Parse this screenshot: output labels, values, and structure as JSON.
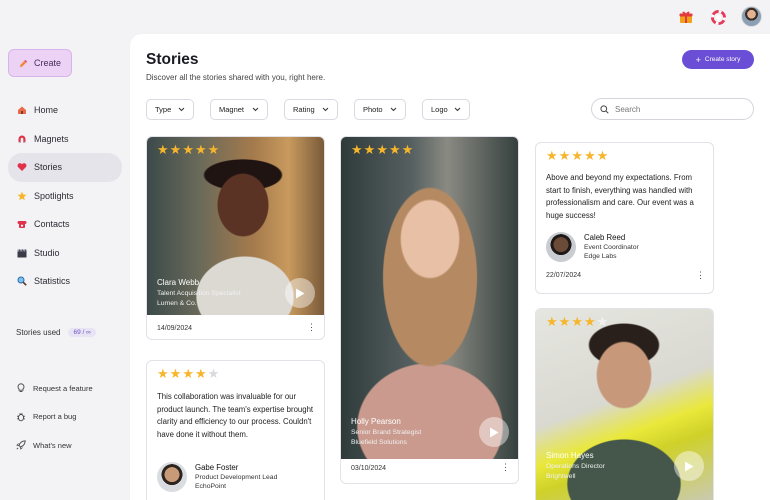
{
  "topbar": {
    "icons": [
      "gift-icon",
      "help-ring-icon",
      "user-avatar"
    ]
  },
  "sidebar": {
    "create_label": "Create",
    "items": [
      {
        "label": "Home",
        "icon": "home-icon"
      },
      {
        "label": "Magnets",
        "icon": "magnet-icon"
      },
      {
        "label": "Stories",
        "icon": "heart-icon",
        "active": true
      },
      {
        "label": "Spotlights",
        "icon": "star-icon"
      },
      {
        "label": "Contacts",
        "icon": "phone-icon"
      },
      {
        "label": "Studio",
        "icon": "clapper-icon"
      },
      {
        "label": "Statistics",
        "icon": "magnifier-icon"
      }
    ],
    "usage_label": "Stories used",
    "usage_value": "69 / ∞",
    "footer": [
      {
        "label": "Request a feature",
        "icon": "bulb-icon"
      },
      {
        "label": "Report a bug",
        "icon": "bug-icon"
      },
      {
        "label": "What's new",
        "icon": "rocket-icon"
      }
    ]
  },
  "main": {
    "title": "Stories",
    "subtitle": "Discover all the stories shared with you, right here.",
    "create_story_label": "Create story",
    "filters": [
      "Type",
      "Magnet",
      "Rating",
      "Photo",
      "Logo"
    ],
    "search_placeholder": "Search"
  },
  "cards": {
    "clara": {
      "rating": 5,
      "name": "Clara Webb",
      "role": "Talent Acquisition Specialist",
      "org": "Lumen & Co.",
      "date": "14/09/2024"
    },
    "gabe": {
      "rating": 4,
      "quote": "This collaboration was invaluable for our product launch. The team's expertise brought clarity and efficiency to our process. Couldn't have done it without them.",
      "name": "Gabe Foster",
      "role": "Product Development Lead",
      "org": "EchoPoint"
    },
    "holly": {
      "rating": 5,
      "name": "Holly Pearson",
      "role": "Senior Brand Strategist",
      "org": "Bluefield Solutions",
      "date": "03/10/2024"
    },
    "caleb": {
      "rating": 5,
      "quote": "Above and beyond my expectations. From start to finish, everything was handled with professionalism and care. Our event was a huge success!",
      "name": "Caleb Reed",
      "role": "Event Coordinator",
      "org": "Edge Labs",
      "date": "22/07/2024"
    },
    "simon": {
      "rating": 4,
      "name": "Simon Hayes",
      "role": "Operations Director",
      "org": "Brightwell"
    }
  },
  "colors": {
    "accent": "#6a4fd6",
    "star": "#f6b52b",
    "create_bg": "#ecd3f5"
  }
}
